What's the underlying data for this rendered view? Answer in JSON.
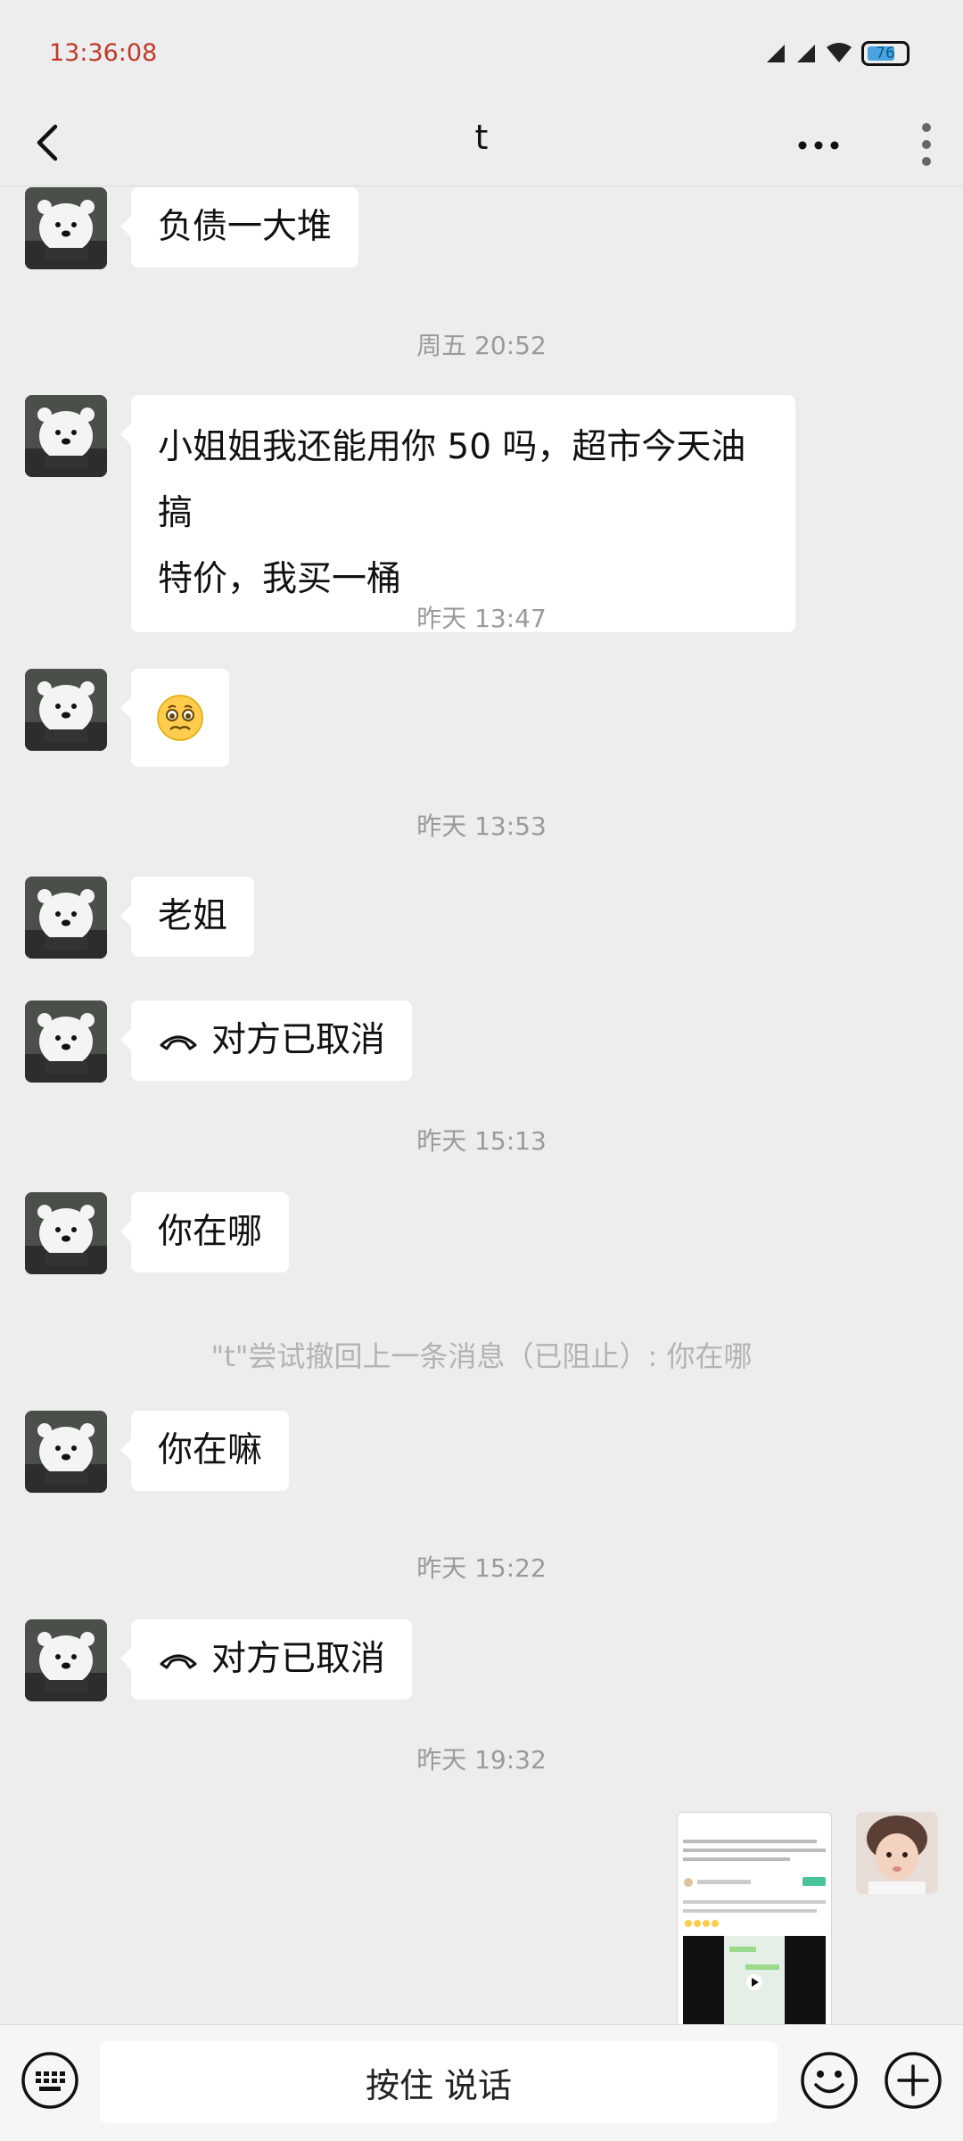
{
  "status_bar": {
    "time": "13:36:08",
    "battery": "76"
  },
  "nav": {
    "title": "t"
  },
  "messages": {
    "m1": "负债一大堆",
    "ts1": "周五 20:52",
    "m2_line1": "小姐姐我还能用你 50 吗，超市今天油搞",
    "m2_line2": "特价，我买一桶",
    "ts2": "昨天 13:47",
    "ts3": "昨天 13:53",
    "m4": "老姐",
    "call1": "对方已取消",
    "ts4": "昨天 15:13",
    "m5": "你在哪",
    "recall_notice": "\"t\"尝试撤回上一条消息（已阻止）: 你在哪",
    "m6": "你在嘛",
    "ts5": "昨天 15:22",
    "call2": "对方已取消",
    "ts6": "昨天 19:32"
  },
  "input_bar": {
    "talk_label": "按住 说话"
  },
  "icons": {
    "back": "chevron-left-icon",
    "more": "more-horizontal-icon",
    "kebab": "more-vertical-icon",
    "call": "phone-hangup-icon",
    "keyboard": "keyboard-icon",
    "emoji": "smile-icon",
    "add": "plus-circle-icon"
  },
  "colors": {
    "background": "#ededed",
    "bubble": "#ffffff",
    "status_time": "#c0392b"
  }
}
